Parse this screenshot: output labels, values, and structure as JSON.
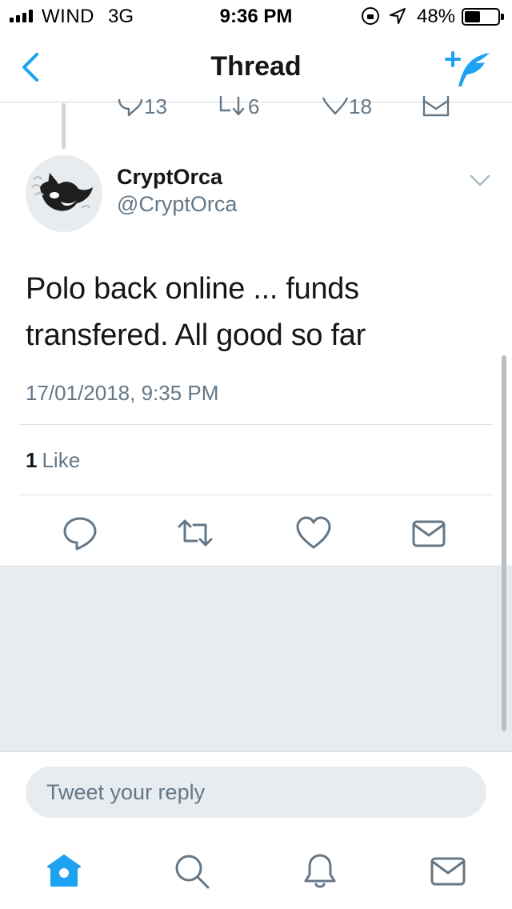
{
  "status_bar": {
    "carrier": "WIND",
    "network": "3G",
    "time": "9:36 PM",
    "battery_percent": "48%",
    "battery_level": 0.48
  },
  "nav": {
    "title": "Thread",
    "back_icon": "chevron-left-icon",
    "compose_icon": "compose-tweet-icon",
    "accent_color": "#1da1f2"
  },
  "previous_tweet": {
    "reply_count": "13",
    "retweet_count": "6",
    "like_count": "18"
  },
  "tweet": {
    "name": "CryptOrca",
    "handle": "@CryptOrca",
    "text_line1": "Polo back online ... funds",
    "text_line2": "transfered. All good so far",
    "timestamp": "17/01/2018, 9:35 PM",
    "likes_count": "1",
    "likes_label": "Like"
  },
  "reply": {
    "placeholder": "Tweet your reply"
  },
  "tabbar": {
    "items": [
      "home-icon",
      "search-icon",
      "notifications-icon",
      "messages-icon"
    ]
  }
}
